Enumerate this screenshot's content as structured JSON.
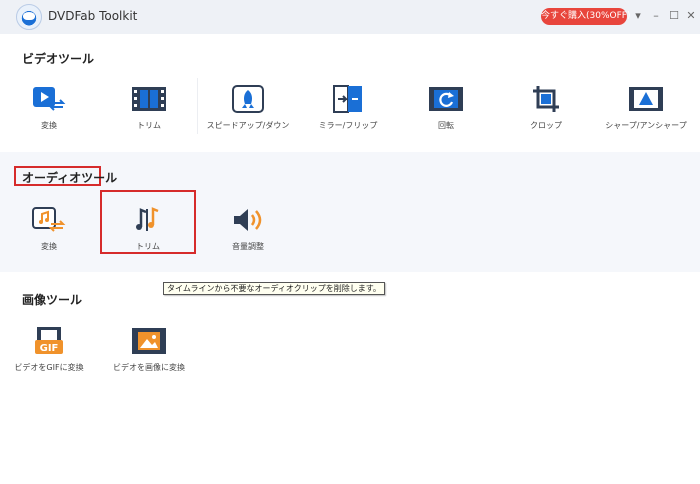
{
  "window": {
    "title": "DVDFab Toolkit",
    "promo_label": "今すぐ購入(30%OFF)",
    "controls": {
      "dropdown": "▾",
      "minimize": "–",
      "maximize": "☐",
      "close": "✕"
    }
  },
  "sections": {
    "video": {
      "title": "ビデオツール",
      "tools": [
        {
          "label": "変換",
          "icon": "video-convert-icon"
        },
        {
          "label": "トリム",
          "icon": "film-trim-icon"
        },
        {
          "label": "スピードアップ/ダウン",
          "icon": "rocket-icon"
        },
        {
          "label": "ミラー/フリップ",
          "icon": "mirror-flip-icon"
        },
        {
          "label": "回転",
          "icon": "rotate-icon"
        },
        {
          "label": "クロップ",
          "icon": "crop-icon"
        },
        {
          "label": "シャープ/アンシャープ",
          "icon": "sharpen-icon"
        }
      ]
    },
    "audio": {
      "title": "オーディオツール",
      "tools": [
        {
          "label": "変換",
          "icon": "audio-convert-icon"
        },
        {
          "label": "トリム",
          "icon": "audio-trim-icon"
        },
        {
          "label": "音量調整",
          "icon": "volume-icon"
        }
      ]
    },
    "image": {
      "title": "画像ツール",
      "tools": [
        {
          "label": "ビデオをGIFに変換",
          "icon": "video-to-gif-icon"
        },
        {
          "label": "ビデオを画像に変換",
          "icon": "video-to-image-icon"
        }
      ]
    }
  },
  "tooltip": {
    "text": "タイムラインから不要なオーディオクリップを削除します。"
  },
  "gif_badge": "GIF",
  "colors": {
    "accent": "#1a6fd6",
    "icon_dark": "#2f3e55",
    "orange": "#f0922b",
    "highlight": "#d62b2b",
    "promo": "#e8453c"
  }
}
